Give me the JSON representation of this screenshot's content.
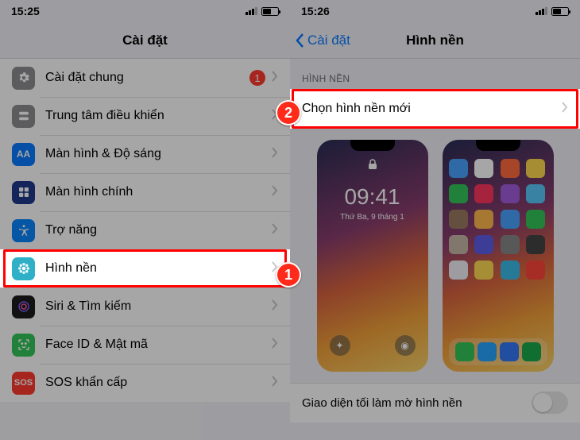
{
  "left": {
    "status_time": "15:25",
    "title": "Cài đặt",
    "rows": {
      "general": {
        "label": "Cài đặt chung",
        "badge": "1"
      },
      "control": {
        "label": "Trung tâm điều khiển"
      },
      "display": {
        "label": "Màn hình & Độ sáng"
      },
      "home": {
        "label": "Màn hình chính"
      },
      "access": {
        "label": "Trợ năng"
      },
      "wall": {
        "label": "Hình nền"
      },
      "siri": {
        "label": "Siri & Tìm kiếm"
      },
      "faceid": {
        "label": "Face ID & Mật mã"
      },
      "sos": {
        "label": "SOS khẩn cấp",
        "icon_text": "SOS"
      }
    }
  },
  "right": {
    "status_time": "15:26",
    "back": "Cài đặt",
    "title": "Hình nền",
    "section": "HÌNH NỀN",
    "choose": "Chọn hình nền mới",
    "lock_time": "09:41",
    "lock_date": "Thứ Ba, 9 tháng 1",
    "dark_label": "Giao diện tối làm mờ hình nền"
  },
  "markers": {
    "m1": "1",
    "m2": "2"
  },
  "home_icon_colors": [
    "#4aa3ff",
    "#fff",
    "#ff6a3d",
    "#ffd84d",
    "#34c759",
    "#ff375f",
    "#a25ddc",
    "#5ac8fa",
    "#9c7b63",
    "#ffb84d",
    "#4aa3ff",
    "#34c759",
    "#c6b7a7",
    "#5e5ce6",
    "#888",
    "#444",
    "#f2f2f7",
    "#ffda55",
    "#3cbce8",
    "#ff453a"
  ],
  "dock_colors": [
    "#34c759",
    "#26a5ff",
    "#3478f6",
    "#1ba94c"
  ]
}
